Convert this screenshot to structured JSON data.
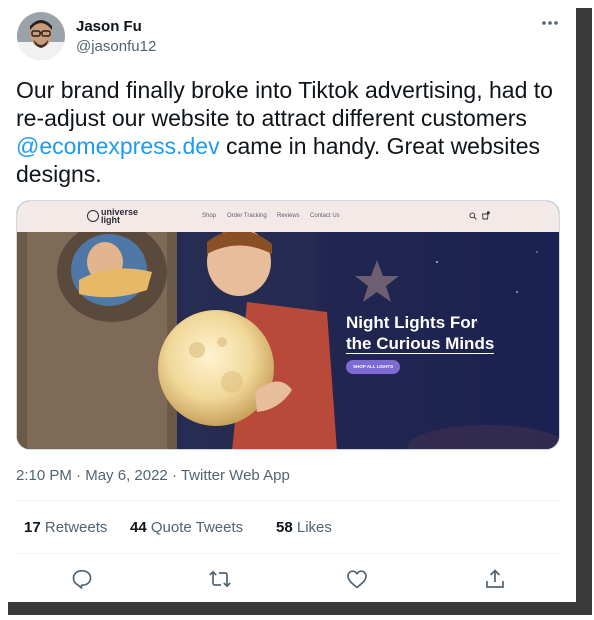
{
  "author": {
    "name": "Jason Fu",
    "handle": "@jasonfu12"
  },
  "tweet": {
    "text_before": "Our brand finally broke into Tiktok advertising, had to re-adjust our website to attract different customers ",
    "mention": "@ecomexpress.dev",
    "text_after": " came in handy. Great websites designs."
  },
  "media": {
    "logo_line1": "universe",
    "logo_line2": "light",
    "nav": [
      "Shop",
      "Order Tracking",
      "Reviews",
      "Contact Us"
    ],
    "hero_title_line1": "Night Lights For",
    "hero_title_line2": "the Curious Minds",
    "hero_button": "SHOP ALL LIGHTS"
  },
  "meta": {
    "time": "2:10 PM",
    "date": "May 6, 2022",
    "source": "Twitter Web App",
    "separator": " · "
  },
  "stats": {
    "retweets_count": "17",
    "retweets_label": "Retweets",
    "quotes_count": "44",
    "quotes_label": "Quote Tweets",
    "likes_count": "58",
    "likes_label": "Likes"
  },
  "colors": {
    "link": "#1d9bf0",
    "text": "#0f1419",
    "muted": "#536471"
  }
}
